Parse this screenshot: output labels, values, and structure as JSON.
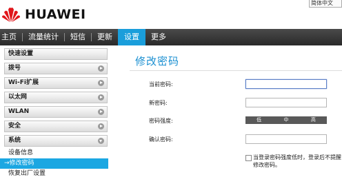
{
  "header": {
    "brand": "HUAWEI",
    "language": "简体中文"
  },
  "nav": {
    "items": [
      {
        "label": "主页"
      },
      {
        "label": "流量统计"
      },
      {
        "label": "短信"
      },
      {
        "label": "更新"
      },
      {
        "label": "设置",
        "active": true
      },
      {
        "label": "更多"
      }
    ]
  },
  "sidebar": {
    "quick_setup": "快速设置",
    "dialup": "拨号",
    "wifi_ext": "Wi-Fi扩展",
    "ethernet": "以太网",
    "wlan": "WLAN",
    "security": "安全",
    "system": "系统",
    "sub_items": [
      {
        "label": "设备信息"
      },
      {
        "label": "→修改密码",
        "active": true
      },
      {
        "label": "恢复出厂设置"
      }
    ]
  },
  "main": {
    "title": "修改密码",
    "current_password_label": "当前密码:",
    "new_password_label": "新密码:",
    "strength_label": "密码强度:",
    "confirm_password_label": "确认密码:",
    "strength_levels": [
      "低",
      "中",
      "高"
    ],
    "warning_text": "当登录密码强度低时，登录后不提醒修改密码。",
    "current_password_value": "",
    "new_password_value": "",
    "confirm_password_value": ""
  },
  "colors": {
    "accent": "#1a9edb",
    "nav_bg": "#3a3a3a",
    "strength_bar": "#595959"
  }
}
